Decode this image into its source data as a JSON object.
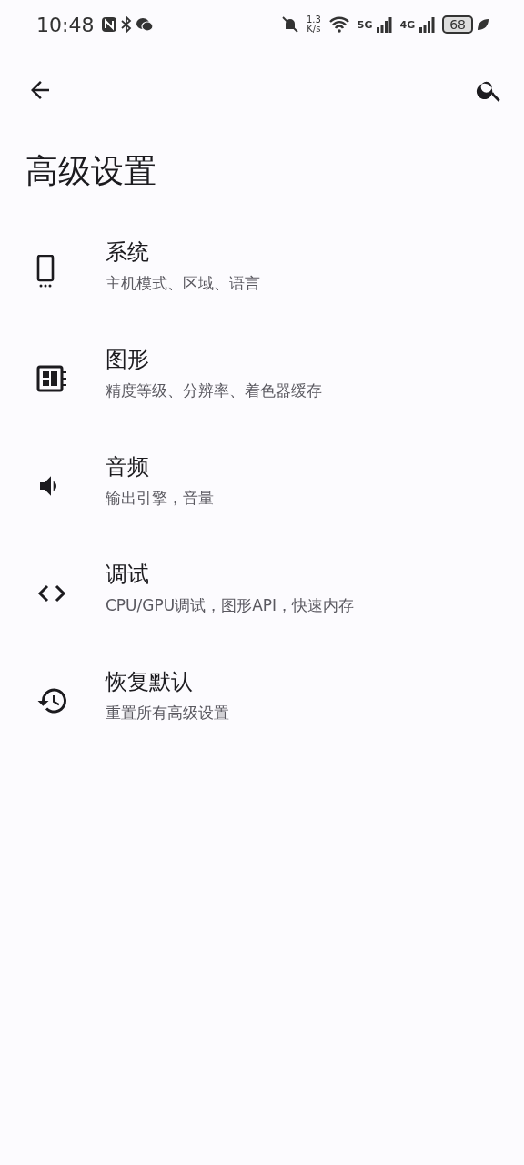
{
  "status_bar": {
    "time": "10:48",
    "speed_value": "1.3",
    "speed_unit": "K/s",
    "network_1": "5G",
    "network_2": "4G",
    "battery": "68"
  },
  "title": "高级设置",
  "items": [
    {
      "kind": "phone",
      "title": "系统",
      "subtitle": "主机模式、区域、语言"
    },
    {
      "kind": "chip",
      "title": "图形",
      "subtitle": "精度等级、分辨率、着色器缓存"
    },
    {
      "kind": "speaker",
      "title": "音频",
      "subtitle": "输出引擎，音量"
    },
    {
      "kind": "code",
      "title": "调试",
      "subtitle": "CPU/GPU调试，图形API，快速内存"
    },
    {
      "kind": "restore",
      "title": "恢复默认",
      "subtitle": "重置所有高级设置"
    }
  ]
}
